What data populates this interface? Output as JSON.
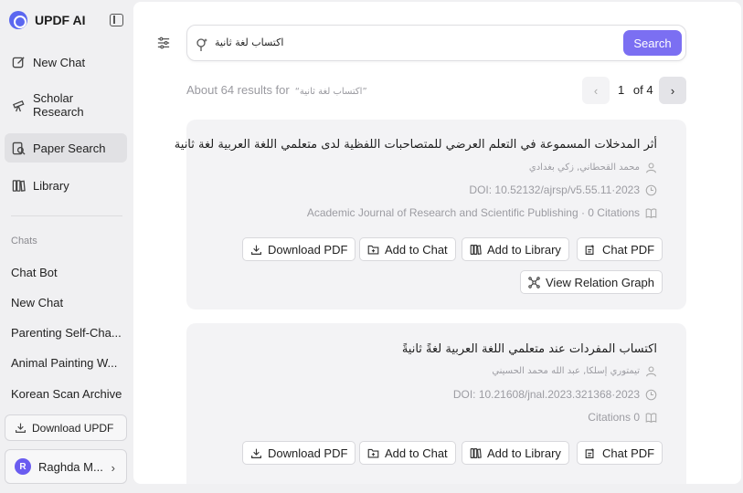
{
  "brand": {
    "name": "UPDF AI"
  },
  "nav": [
    {
      "label": "New Chat"
    },
    {
      "label": "Scholar\nResearch"
    },
    {
      "label": "Paper Search"
    },
    {
      "label": "Library"
    }
  ],
  "chats": {
    "heading": "Chats",
    "items": [
      "Chat Bot",
      "New Chat",
      "Parenting Self-Cha...",
      "Animal Painting W...",
      "Korean Scan Archive"
    ]
  },
  "download_button": "Download UPDF",
  "user": {
    "initial": "R",
    "name": "Raghda M..."
  },
  "search": {
    "value": "اكتساب لغة ثانية",
    "button": "Search"
  },
  "results": {
    "prefix": "About 64 results for",
    "query": "“اكتساب لغة ثانية”"
  },
  "pager": {
    "current": "1",
    "of": "of 4"
  },
  "cards": [
    {
      "title": "أثر المدخلات المسموعة في التعلم العرضي للمتصاحبات اللفظية لدى متعلمي اللغة العربية لغة ثانية",
      "authors": "محمد القحطاني, زكي بغدادي",
      "doi": "DOI: 10.52132/ajrsp/v5.55.11·2023",
      "source": "Academic Journal of Research and Scientific Publishing · 0 Citations",
      "buttons": [
        "Download PDF",
        "Add to Chat",
        "Add to Library",
        "Chat PDF"
      ],
      "extra_button": "View Relation Graph"
    },
    {
      "title": "اكتساب المفردات عند متعلمي اللغة العربية لغةً ثانيةً",
      "authors": "تيمتوري إسلكا, عبد الله محمد الحسيني",
      "doi": "DOI: 10.21608/jnal.2023.321368·2023",
      "source": "Citations 0",
      "buttons": [
        "Download PDF",
        "Add to Chat",
        "Add to Library",
        "Chat PDF"
      ]
    }
  ],
  "colors": {
    "accent": "#7b6ff2",
    "card_bg": "#f3f3f5",
    "sidebar_bg": "#f0f0f2"
  }
}
